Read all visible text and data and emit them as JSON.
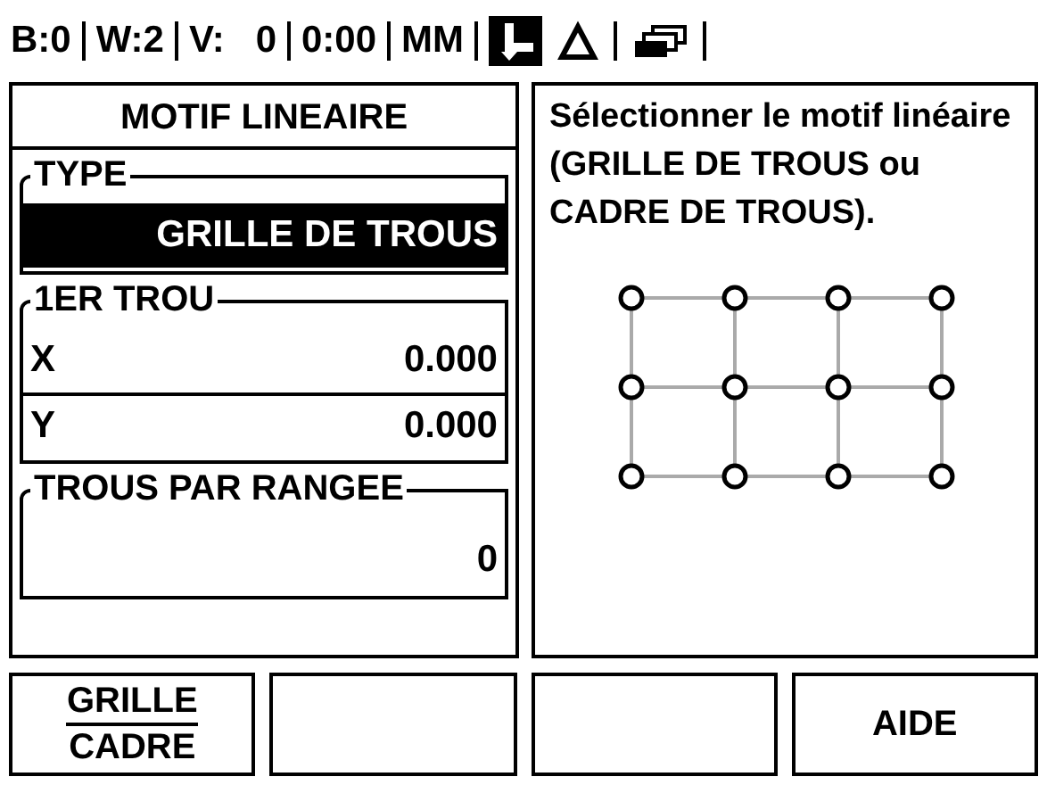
{
  "status_bar": [
    {
      "kind": "text",
      "text": "B:0"
    },
    {
      "kind": "text",
      "text": "W:2"
    },
    {
      "kind": "text",
      "text": "V:   0"
    },
    {
      "kind": "text",
      "text": "0:00"
    },
    {
      "kind": "text",
      "text": "MM"
    },
    {
      "kind": "datum",
      "selected": true
    },
    {
      "kind": "delta",
      "selected": false
    },
    {
      "kind": "windows",
      "selected": false
    }
  ],
  "form": {
    "title": "MOTIF LINEAIRE",
    "groups": [
      {
        "legend": "TYPE",
        "fields": [
          {
            "kind": "choice",
            "value": "GRILLE DE TROUS",
            "selected": true
          }
        ]
      },
      {
        "legend": "1ER TROU",
        "fields": [
          {
            "kind": "axis",
            "label": "X",
            "value": "0.000",
            "selected": false
          },
          {
            "kind": "axis",
            "label": "Y",
            "value": "0.000",
            "selected": false
          }
        ]
      },
      {
        "legend": "TROUS PAR RANGEE",
        "fields": [
          {
            "kind": "number",
            "value": "0",
            "selected": false
          }
        ]
      }
    ]
  },
  "help": {
    "text": "Sélectionner le motif linéaire (GRILLE DE TROUS ou CADRE DE TROUS)."
  },
  "softkeys": [
    {
      "kind": "toggle",
      "options": [
        {
          "label": "GRILLE",
          "selected": true
        },
        {
          "label": "CADRE",
          "selected": false
        }
      ]
    },
    {
      "kind": "blank"
    },
    {
      "kind": "blank"
    },
    {
      "kind": "action",
      "options": [
        {
          "label": "AIDE",
          "selected": false
        }
      ]
    }
  ]
}
